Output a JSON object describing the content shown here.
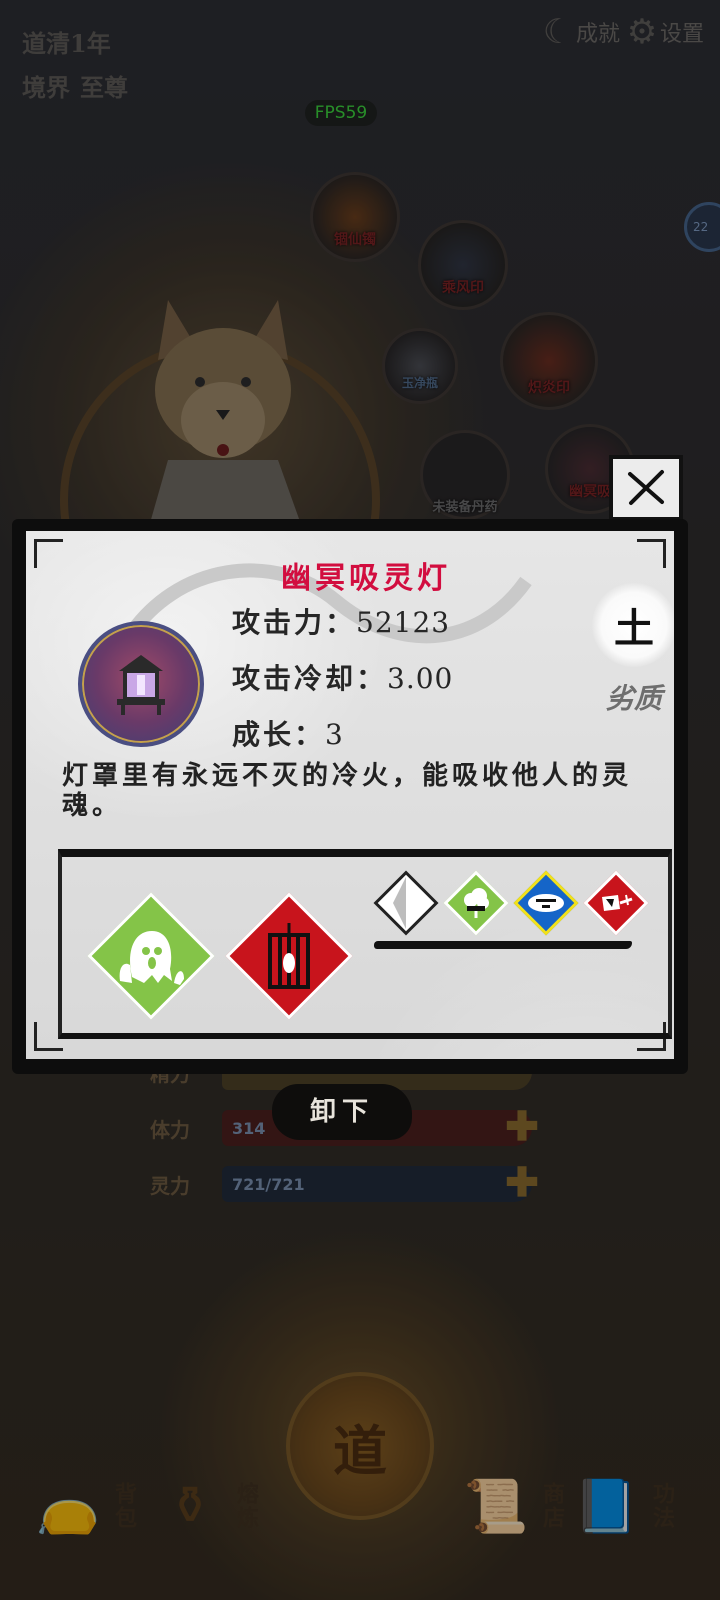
{
  "top_bar": {
    "dao_time": "道清1年",
    "realm_label": "境界",
    "realm_value": "至尊",
    "achievements_label": "成就",
    "settings_label": "设置",
    "fps": "FPS59",
    "side_badge": "22"
  },
  "equipment_slots": [
    {
      "label": "锢仙镯"
    },
    {
      "label": "乘风印"
    },
    {
      "label": "玉净瓶"
    },
    {
      "label": "炽炎印"
    },
    {
      "label": "未装备丹药"
    },
    {
      "label": "幽冥吸"
    }
  ],
  "stats_background": {
    "row0_label": "精力",
    "stamina_label": "体力",
    "stamina_value": "314",
    "spirit_label": "灵力",
    "spirit_value": "721/721"
  },
  "item_dialog": {
    "title": "幽冥吸灵灯",
    "attack_label": "攻击力：",
    "attack_value": "52123",
    "cooldown_label": "攻击冷却：",
    "cooldown_value": "3.00",
    "growth_label": "成长：",
    "growth_value": "3",
    "element": "土",
    "quality": "劣质",
    "description": "灯罩里有永远不灭的冷火，能吸收他人的灵魂。",
    "skills_large": [
      {
        "icon": "ghost-icon",
        "color": "#84c448"
      },
      {
        "icon": "cage-icon",
        "color": "#c8141c"
      }
    ],
    "skills_small": [
      {
        "icon": "split-diamond-icon",
        "color": "#ffffff"
      },
      {
        "icon": "cloud-burst-icon",
        "color": "#84c448"
      },
      {
        "icon": "eye-rune-icon",
        "color": "#1565c8"
      },
      {
        "icon": "stab-icon",
        "color": "#c8141c"
      }
    ],
    "unequip_label": "卸下"
  },
  "bottom_nav": {
    "bag_label": "背包",
    "forge_label": "熔炼",
    "dao_label": "道",
    "shop_label": "商店",
    "skills_label": "功法"
  },
  "colors": {
    "title_red": "#d20d3f",
    "fps_green": "#39d63a",
    "dialog_bg": "#dcdcdc"
  }
}
